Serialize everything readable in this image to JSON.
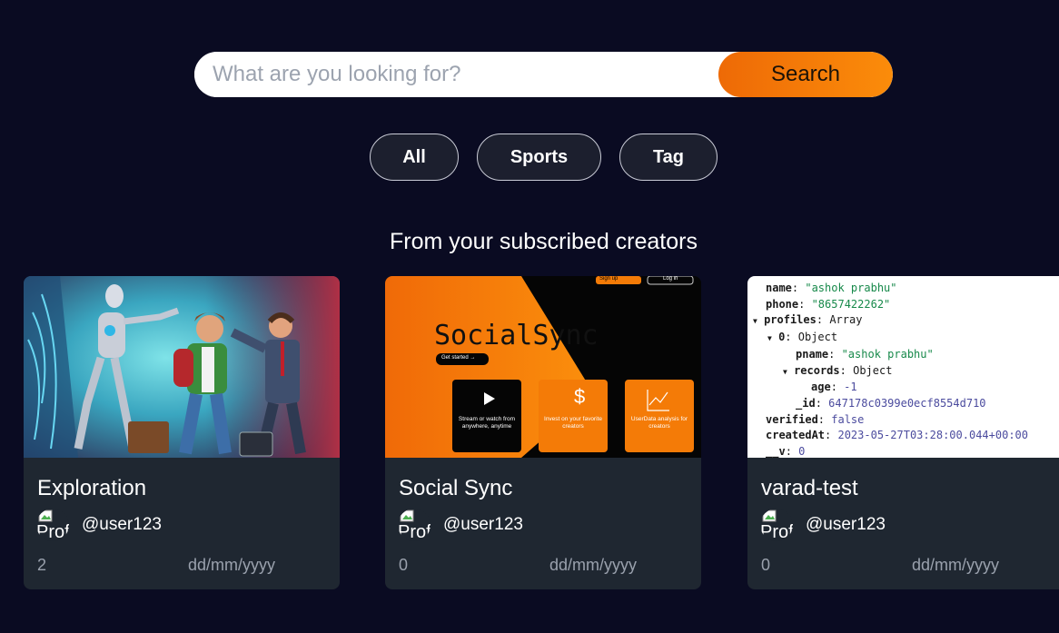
{
  "search": {
    "placeholder": "What are you looking for?",
    "button_label": "Search"
  },
  "filters": [
    {
      "label": "All"
    },
    {
      "label": "Sports"
    },
    {
      "label": "Tag"
    }
  ],
  "section": {
    "title": "From your subscribed creators"
  },
  "cards": [
    {
      "title": "Exploration",
      "author": "@user123",
      "avatar_alt": "Prof",
      "views": "2",
      "date": "dd/mm/yyyy"
    },
    {
      "title": "Social Sync",
      "author": "@user123",
      "avatar_alt": "Prof",
      "views": "0",
      "date": "dd/mm/yyyy",
      "thumbnail": {
        "brand": "SocialSync",
        "signup": "Sign up",
        "login": "Log in",
        "get_started": "Get started →",
        "features": [
          {
            "text": "Stream or watch from anywhere, anytime"
          },
          {
            "text": "Invest on your favorite creators"
          },
          {
            "text": "UserData analysis for creators"
          }
        ]
      }
    },
    {
      "title": "varad-test",
      "author": "@user123",
      "avatar_alt": "Prof",
      "views": "0",
      "date": "dd/mm/yyyy",
      "thumbnail": {
        "json_lines": {
          "name_key": "name",
          "name_val": "\"ashok prabhu\"",
          "phone_key": "phone",
          "phone_val": "\"8657422262\"",
          "profiles_key": "profiles",
          "profiles_val": "Array",
          "zero_key": "0",
          "zero_val": "Object",
          "pname_key": "pname",
          "pname_val": "\"ashok prabhu\"",
          "records_key": "records",
          "records_val": "Object",
          "age_key": "age",
          "age_val": "-1",
          "id_key": "_id",
          "id_val": "647178c0399e0ecf8554d710",
          "verified_key": "verified",
          "verified_val": "false",
          "created_key": "createdAt",
          "created_val": "2023-05-27T03:28:00.044+00:00",
          "v_key": "__v",
          "v_val": "0"
        }
      }
    }
  ],
  "colors": {
    "background": "#0a0b22",
    "accent": "#f47b07",
    "card": "#1f2731"
  }
}
